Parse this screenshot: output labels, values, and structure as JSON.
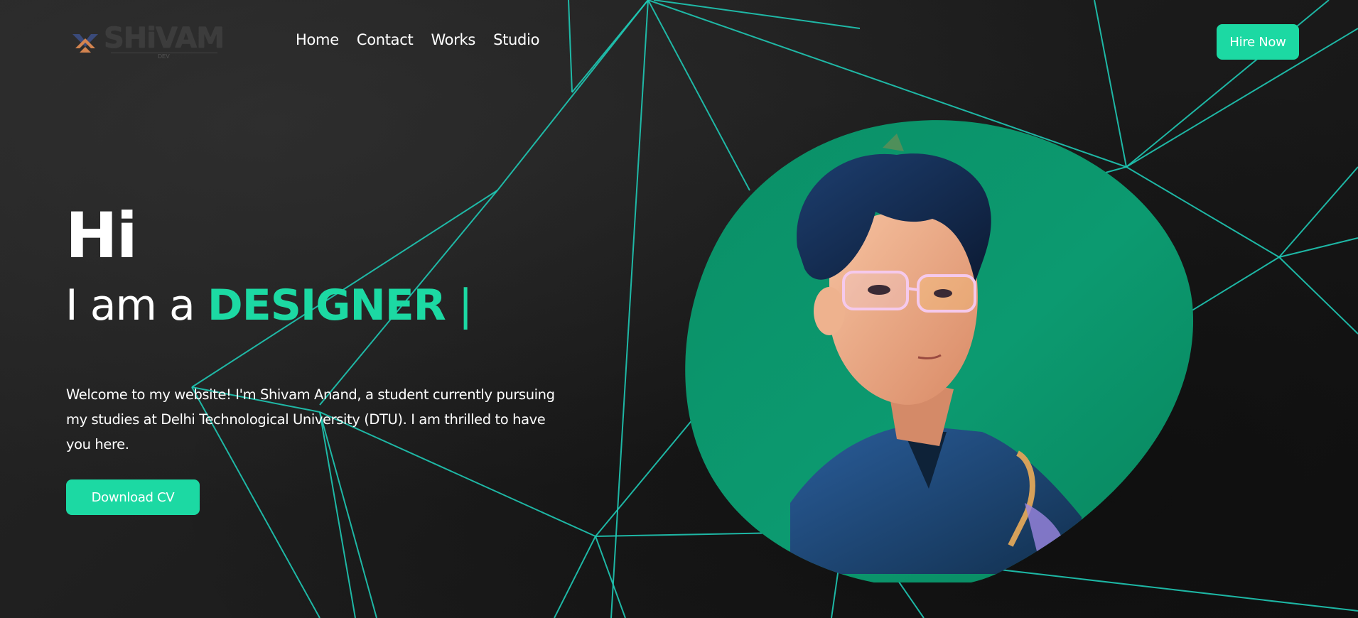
{
  "brand": {
    "logo_text": "SHiVAM",
    "logo_sub": "DEV",
    "accent_color": "#1cd9a3",
    "line_color": "#1fc9b5",
    "blob_color": "#0c9a70"
  },
  "nav": {
    "items": [
      {
        "label": "Home"
      },
      {
        "label": "Contact"
      },
      {
        "label": "Works"
      },
      {
        "label": "Studio"
      }
    ]
  },
  "header": {
    "hire_label": "Hire Now"
  },
  "hero": {
    "greeting": "Hi",
    "role_prefix": "I am a ",
    "role_word": "DESIGNER",
    "cursor": " |",
    "intro": "Welcome to my website! I'm Shivam Anand, a student currently pursuing my studies at Delhi Technological University (DTU). I am thrilled to have you here.",
    "download_label": "Download CV"
  },
  "portrait": {
    "icon": "avatar-illustration"
  }
}
